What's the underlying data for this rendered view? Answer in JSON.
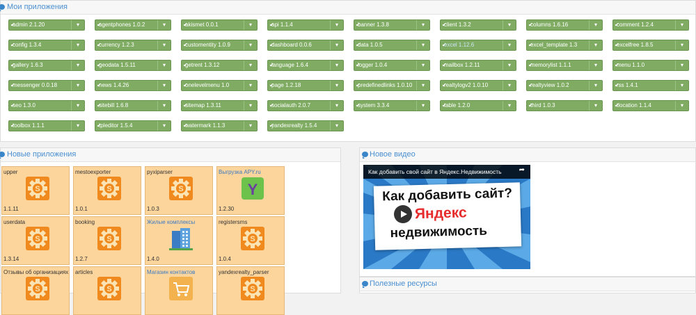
{
  "sections": {
    "my_apps": "Мои приложения",
    "new_apps": "Новые приложения",
    "new_video": "Новое видео",
    "resources": "Полезные ресурсы"
  },
  "apps": [
    {
      "label": "admin 2.1.20",
      "check": "✔"
    },
    {
      "label": "agentphones 1.0.2",
      "check": "✔"
    },
    {
      "label": "akismet 0.0.1",
      "check": "✔"
    },
    {
      "label": "api 1.1.4",
      "check": "✔"
    },
    {
      "label": "banner 1.3.8",
      "check": "✔"
    },
    {
      "label": "client 1.3.2",
      "check": "✔"
    },
    {
      "label": "columns 1.6.16",
      "check": "✔"
    },
    {
      "label": "comment 1.2.4",
      "check": "✔"
    },
    {
      "label": "config 1.3.4",
      "check": "✔"
    },
    {
      "label": "currency 1.2.3",
      "check": "✔"
    },
    {
      "label": "customentity 1.0.9",
      "check": "✔"
    },
    {
      "label": "dashboard 0.0.6",
      "check": "✔"
    },
    {
      "label": "data 1.0.5",
      "check": "✔"
    },
    {
      "label": "excel 1.12.6",
      "check": "✔"
    },
    {
      "label": "excel_template 1.3",
      "check": "✔"
    },
    {
      "label": "excelfree 1.8.5",
      "check": "✔"
    },
    {
      "label": "gallery 1.6.3",
      "check": "✔"
    },
    {
      "label": "geodata 1.5.11",
      "check": "✔"
    },
    {
      "label": "getrent 1.3.12",
      "check": "✔"
    },
    {
      "label": "language 1.6.4",
      "check": "✔"
    },
    {
      "label": "logger 1.0.4",
      "check": "✔"
    },
    {
      "label": "mailbox 1.2.11",
      "check": "✔"
    },
    {
      "label": "memorylist 1.1.1",
      "check": "✔"
    },
    {
      "label": "menu 1.1.0",
      "check": "✔"
    },
    {
      "label": "messenger 0.0.18",
      "check": "✔"
    },
    {
      "label": "news 1.4.26",
      "check": "✔"
    },
    {
      "label": "onelevelmenu 1.0",
      "check": "✔"
    },
    {
      "label": "page 1.2.18",
      "check": "✔"
    },
    {
      "label": "predefinedlinks 1.0.10",
      "check": "✔"
    },
    {
      "label": "realtylogv2 1.0.10",
      "check": "✔"
    },
    {
      "label": "realtyview 1.0.2",
      "check": "✔"
    },
    {
      "label": "rss 1.4.1",
      "check": "✔"
    },
    {
      "label": "seo 1.3.0",
      "check": "✔"
    },
    {
      "label": "sitebill 1.6.8",
      "check": "✔"
    },
    {
      "label": "sitemap 1.3.11",
      "check": "✔"
    },
    {
      "label": "socialauth 2.0.7",
      "check": "✔"
    },
    {
      "label": "system 3.3.4",
      "check": "✔"
    },
    {
      "label": "table 1.2.0",
      "check": "✔"
    },
    {
      "label": "third 1.0.3",
      "check": "✔"
    },
    {
      "label": "tlocation 1.1.4",
      "check": "✔"
    },
    {
      "label": "toolbox 1.1.1",
      "check": "✔"
    },
    {
      "label": "tpleditor 1.5.4",
      "check": "✔"
    },
    {
      "label": "watermark 1.1.3",
      "check": "✔"
    },
    {
      "label": "yandexrealty 1.5.4",
      "check": "✔"
    }
  ],
  "dropdown_caret": "▾",
  "new_apps": [
    {
      "name": "upper",
      "version": "1.1.11",
      "icon": "gear-icon"
    },
    {
      "name": "mestoexporter",
      "version": "1.0.1",
      "icon": "gear-icon"
    },
    {
      "name": "pyxiparser",
      "version": "1.0.3",
      "icon": "gear-icon"
    },
    {
      "name": "Выгрузка APY.ru",
      "version": "1.2.30",
      "icon": "apy-logo-icon"
    },
    {
      "name": "userdata",
      "version": "1.3.14",
      "icon": "gear-icon"
    },
    {
      "name": "booking",
      "version": "1.2.7",
      "icon": "gear-icon"
    },
    {
      "name": "Жилые комплексы",
      "version": "1.4.0",
      "icon": "building-icon"
    },
    {
      "name": "registersms",
      "version": "1.0.4",
      "icon": "gear-icon"
    },
    {
      "name": "Отзывы об организациях",
      "version": "",
      "icon": "gear-icon"
    },
    {
      "name": "articles",
      "version": "",
      "icon": "gear-icon"
    },
    {
      "name": "Магазин контактов",
      "version": "",
      "icon": "cart-icon"
    },
    {
      "name": "yandexrealty_parser",
      "version": "",
      "icon": "gear-icon"
    }
  ],
  "video": {
    "title": "Как добавить свой сайт в Яндекс.Недвижимость",
    "line1": "Как добавить сайт?",
    "line2_brand": "Яндекс",
    "line3": "недвижимость",
    "share_icon": "share-icon",
    "play_icon": "play-icon"
  },
  "colors": {
    "app_button": "#7fac62",
    "tile_bg": "#fcd59c",
    "accent": "#4a8fd0",
    "gear": "#f08a1e"
  }
}
